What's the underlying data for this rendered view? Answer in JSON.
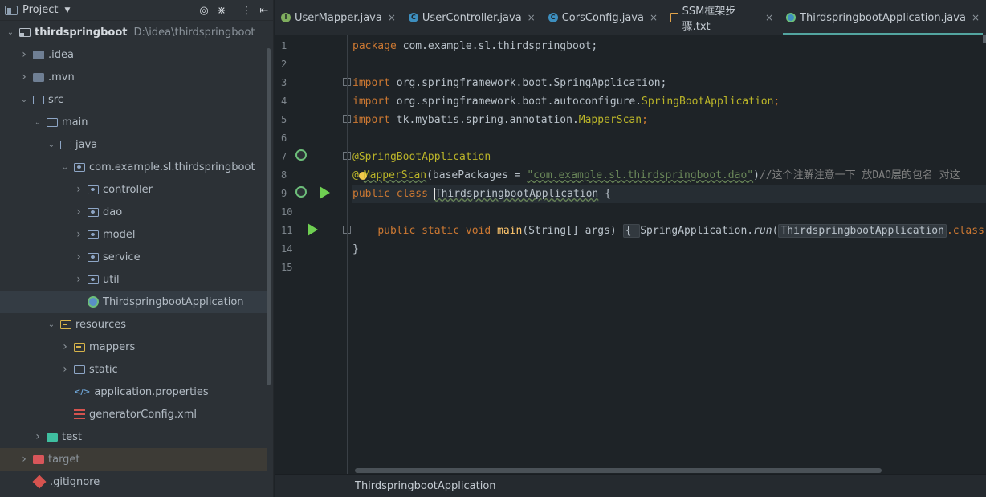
{
  "project": {
    "header_title": "Project",
    "tree": [
      {
        "name": "thirdspringboot",
        "path": "D:\\idea\\thirdspringboot",
        "depth": 0,
        "expanded": true,
        "icon": "module-folder-icon",
        "bold": true
      },
      {
        "name": ".idea",
        "depth": 1,
        "expanded": false,
        "icon": "folder-filled-icon"
      },
      {
        "name": ".mvn",
        "depth": 1,
        "expanded": false,
        "icon": "folder-filled-icon"
      },
      {
        "name": "src",
        "depth": 1,
        "expanded": true,
        "icon": "folder-icon"
      },
      {
        "name": "main",
        "depth": 2,
        "expanded": true,
        "icon": "folder-icon"
      },
      {
        "name": "java",
        "depth": 3,
        "expanded": true,
        "icon": "source-folder-icon"
      },
      {
        "name": "com.example.sl.thirdspringboot",
        "depth": 4,
        "expanded": true,
        "icon": "package-icon"
      },
      {
        "name": "controller",
        "depth": 5,
        "expanded": false,
        "icon": "package-icon"
      },
      {
        "name": "dao",
        "depth": 5,
        "expanded": false,
        "icon": "package-icon"
      },
      {
        "name": "model",
        "depth": 5,
        "expanded": false,
        "icon": "package-icon"
      },
      {
        "name": "service",
        "depth": 5,
        "expanded": false,
        "icon": "package-icon"
      },
      {
        "name": "util",
        "depth": 5,
        "expanded": false,
        "icon": "package-icon"
      },
      {
        "name": "ThirdspringbootApplication",
        "depth": 5,
        "leaf": true,
        "icon": "spring-boot-class-icon",
        "selected": true
      },
      {
        "name": "resources",
        "depth": 3,
        "expanded": true,
        "icon": "resources-folder-icon"
      },
      {
        "name": "mappers",
        "depth": 4,
        "expanded": false,
        "icon": "resources-folder-icon"
      },
      {
        "name": "static",
        "depth": 4,
        "expanded": false,
        "icon": "folder-icon"
      },
      {
        "name": "application.properties",
        "depth": 4,
        "leaf": true,
        "icon": "properties-file-icon"
      },
      {
        "name": "generatorConfig.xml",
        "depth": 4,
        "leaf": true,
        "icon": "xml-file-icon"
      },
      {
        "name": "test",
        "depth": 2,
        "expanded": false,
        "icon": "test-folder-icon"
      },
      {
        "name": "target",
        "depth": 1,
        "expanded": false,
        "icon": "excluded-folder-icon",
        "highlight": true
      },
      {
        "name": ".gitignore",
        "depth": 1,
        "leaf": true,
        "icon": "git-file-icon"
      }
    ]
  },
  "tabs": [
    {
      "label": "UserMapper.java",
      "icon": "interface-icon",
      "glyph": "I",
      "active": false
    },
    {
      "label": "UserController.java",
      "icon": "class-icon",
      "glyph": "C",
      "active": false
    },
    {
      "label": "CorsConfig.java",
      "icon": "class-icon",
      "glyph": "C",
      "active": false
    },
    {
      "label": "SSM框架步骤.txt",
      "icon": "text-file-icon",
      "glyph": "",
      "active": false
    },
    {
      "label": "ThirdspringbootApplication.java",
      "icon": "spring-boot-class-icon",
      "glyph": "",
      "active": true
    }
  ],
  "tab_close_glyph": "×",
  "gutter": {
    "line_numbers": [
      "1",
      "2",
      "3",
      "4",
      "5",
      "6",
      "7",
      "8",
      "9",
      "10",
      "11",
      "14",
      "15"
    ]
  },
  "code": {
    "l1": {
      "kw": "package",
      "rest": " com.example.sl.thirdspringboot;"
    },
    "l3": {
      "kw": "import",
      "rest": " org.springframework.boot.SpringApplication;"
    },
    "l4": {
      "kw": "import",
      "rest": " org.springframework.boot.autoconfigure.",
      "cls": "SpringBootApplication",
      "end": ";"
    },
    "l5": {
      "kw": "import",
      "rest": " tk.mybatis.spring.annotation.",
      "cls": "MapperScan",
      "end": ";"
    },
    "l7": {
      "ann": "@SpringBootApplication"
    },
    "l8": {
      "ann_at": "@",
      "ann_name": "MapperScan",
      "open": "(basePackages = ",
      "str": "\"com.example.sl.thirdspringboot.dao\"",
      "close": ")",
      "comment": "//这个注解注意一下 放DAO层的包名 对这"
    },
    "l9": {
      "kw": "public class ",
      "cls": "ThirdspringbootApplication",
      "end": " {"
    },
    "l11": {
      "kw": "public static void ",
      "fn": "main",
      "args": "(String[] args) ",
      "body_open": "{ ",
      "call": "SpringApplication.",
      "method": "run",
      "arg_open": "(",
      "arg_cls": "ThirdspringbootApplication",
      "arg_end": ".class"
    },
    "l14": {
      "text": "}"
    }
  },
  "breadcrumb": "ThirdspringbootApplication"
}
